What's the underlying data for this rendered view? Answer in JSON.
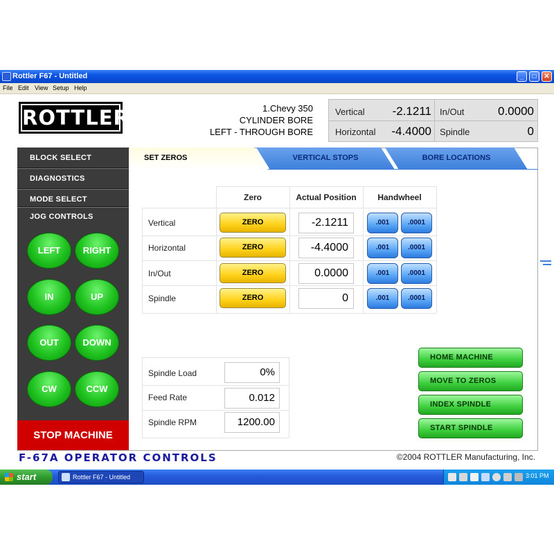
{
  "window": {
    "title": "Rottler F67 - Untitled",
    "controls": {
      "minimize": "_",
      "maximize": "□",
      "close": "✕"
    }
  },
  "menu": [
    "File",
    "Edit",
    "View",
    "Setup",
    "Help"
  ],
  "logo_text": "ROTTLER",
  "job": {
    "line1": "1.Chevy 350",
    "line2": "CYLINDER BORE",
    "line3": "LEFT - THROUGH BORE"
  },
  "dro": {
    "vertical_label": "Vertical",
    "vertical_value": "-2.1211",
    "horizontal_label": "Horizontal",
    "horizontal_value": "-4.4000",
    "inout_label": "In/Out",
    "inout_value": "0.0000",
    "spindle_label": "Spindle",
    "spindle_value": "0"
  },
  "nav": {
    "block_select": "BLOCK SELECT",
    "diagnostics": "DIAGNOSTICS",
    "mode_select": "MODE SELECT",
    "jog_controls": "JOG CONTROLS"
  },
  "jog": {
    "left": "LEFT",
    "right": "RIGHT",
    "in": "IN",
    "up": "UP",
    "out": "OUT",
    "down": "DOWN",
    "cw": "CW",
    "ccw": "CCW"
  },
  "stop_label": "STOP MACHINE",
  "tabs": {
    "set_zeros": "SET ZEROS",
    "vertical_stops": "VERTICAL STOPS",
    "bore_locations": "BORE LOCATIONS"
  },
  "zero_table": {
    "headers": {
      "zero": "Zero",
      "actual": "Actual Position",
      "handwheel": "Handwheel"
    },
    "rows": [
      {
        "label": "Vertical",
        "zero": "ZERO",
        "value": "-2.1211",
        "hw1": ".001",
        "hw2": ".0001"
      },
      {
        "label": "Horizontal",
        "zero": "ZERO",
        "value": "-4.4000",
        "hw1": ".001",
        "hw2": ".0001"
      },
      {
        "label": "In/Out",
        "zero": "ZERO",
        "value": "0.0000",
        "hw1": ".001",
        "hw2": ".0001"
      },
      {
        "label": "Spindle",
        "zero": "ZERO",
        "value": "0",
        "hw1": ".001",
        "hw2": ".0001"
      }
    ]
  },
  "status": {
    "spindle_load_label": "Spindle Load",
    "spindle_load_value": "0%",
    "feed_rate_label": "Feed Rate",
    "feed_rate_value": "0.012",
    "spindle_rpm_label": "Spindle RPM",
    "spindle_rpm_value": "1200.00"
  },
  "actions": {
    "home_machine": "HOME MACHINE",
    "move_to_zeros": "MOVE TO ZEROS",
    "index_spindle": "INDEX SPINDLE",
    "start_spindle": "START SPINDLE"
  },
  "footer": {
    "left": "F-67A OPERATOR CONTROLS",
    "right": "©2004 ROTTLER Manufacturing, Inc."
  },
  "taskbar": {
    "start": "start",
    "window_button": "Rottler F67 - Untitled",
    "clock": "3:01 PM"
  },
  "colors": {
    "title_bar": "#0a54e3",
    "nav_bg": "#3b3b3b",
    "jog_green": "#1fc21f",
    "stop_red": "#d10000",
    "zero_yellow": "#ffd21a",
    "handwheel_blue": "#5aa6f5",
    "tab_blue": "#3d7fdc",
    "action_green": "#3ed03e"
  }
}
